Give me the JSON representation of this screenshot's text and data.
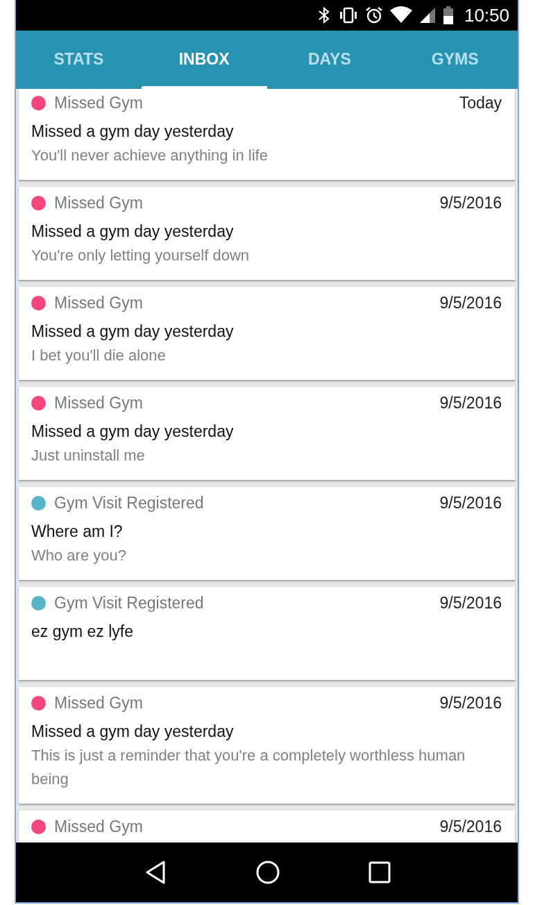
{
  "status_bar": {
    "time": "10:50"
  },
  "tabs": [
    {
      "label": "STATS",
      "selected": false
    },
    {
      "label": "INBOX",
      "selected": true
    },
    {
      "label": "DAYS",
      "selected": false
    },
    {
      "label": "GYMS",
      "selected": false
    }
  ],
  "messages": [
    {
      "category": "Missed Gym",
      "color": "#f2467f",
      "date": "Today",
      "title": "Missed a gym day yesterday",
      "body": "You'll never achieve anything in life"
    },
    {
      "category": "Missed Gym",
      "color": "#f2467f",
      "date": "9/5/2016",
      "title": "Missed a gym day yesterday",
      "body": "You're only letting yourself down"
    },
    {
      "category": "Missed Gym",
      "color": "#f2467f",
      "date": "9/5/2016",
      "title": "Missed a gym day yesterday",
      "body": "I bet you'll die alone"
    },
    {
      "category": "Missed Gym",
      "color": "#f2467f",
      "date": "9/5/2016",
      "title": "Missed a gym day yesterday",
      "body": "Just uninstall me"
    },
    {
      "category": "Gym Visit Registered",
      "color": "#5ab4c8",
      "date": "9/5/2016",
      "title": "Where am I?",
      "body": "Who are you?"
    },
    {
      "category": "Gym Visit Registered",
      "color": "#5ab4c8",
      "date": "9/5/2016",
      "title": "ez gym ez lyfe"
    },
    {
      "category": "Missed Gym",
      "color": "#f2467f",
      "date": "9/5/2016",
      "title": "Missed a gym day yesterday",
      "body": "This is just a reminder that you're a completely worthless human being"
    },
    {
      "category": "Missed Gym",
      "color": "#f2467f",
      "date": "9/5/2016"
    }
  ]
}
